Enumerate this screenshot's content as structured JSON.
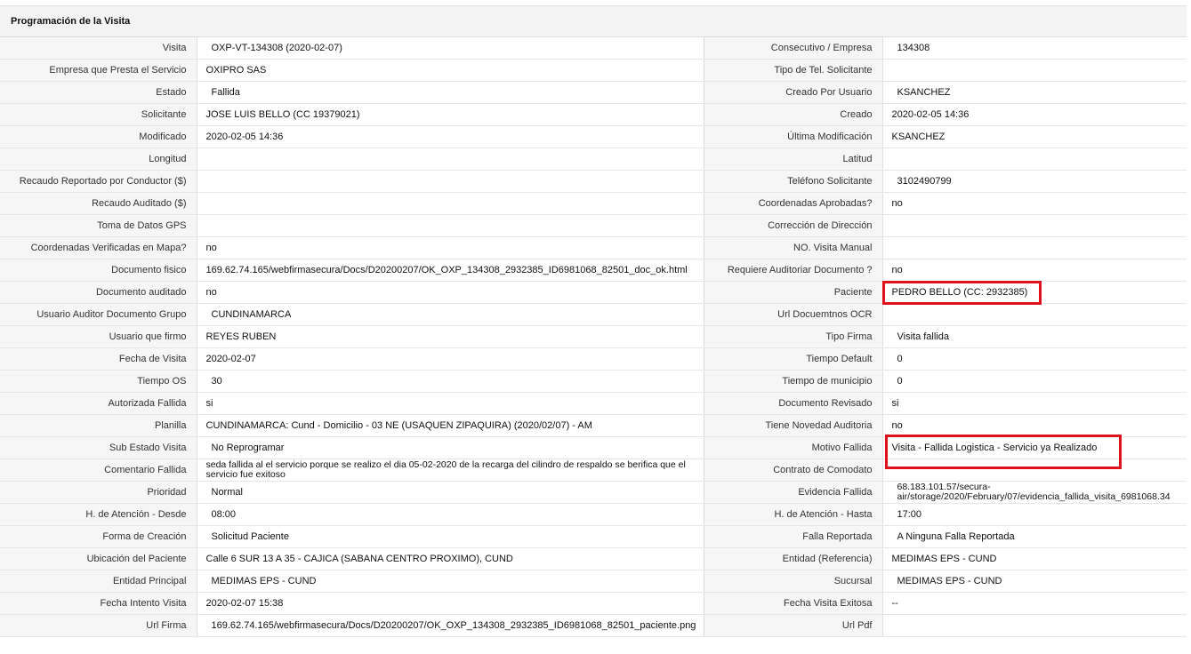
{
  "panel": {
    "title": "Programación de la Visita"
  },
  "colors": {
    "highlight": "#e0101c"
  },
  "rows": [
    {
      "l1": "Visita",
      "v1": "OXP-VT-134308 (2020-02-07)",
      "l2": "Consecutivo / Empresa",
      "v2": "134308"
    },
    {
      "l1": "Empresa que Presta el Servicio",
      "v1": "OXIPRO SAS",
      "l2": "Tipo de Tel. Solicitante",
      "v2": ""
    },
    {
      "l1": "Estado",
      "v1": "Fallida",
      "l2": "Creado Por Usuario",
      "v2": "KSANCHEZ"
    },
    {
      "l1": "Solicitante",
      "v1": "JOSE LUIS BELLO (CC 19379021)",
      "l2": "Creado",
      "v2": "2020-02-05 14:36"
    },
    {
      "l1": "Modificado",
      "v1": "2020-02-05 14:36",
      "l2": "Última Modificación",
      "v2": "KSANCHEZ"
    },
    {
      "l1": "Longitud",
      "v1": "",
      "l2": "Latitud",
      "v2": ""
    },
    {
      "l1": "Recaudo Reportado por Conductor ($)",
      "v1": "",
      "l2": "Teléfono Solicitante",
      "v2": "3102490799"
    },
    {
      "l1": "Recaudo Auditado ($)",
      "v1": "",
      "l2": "Coordenadas Aprobadas?",
      "v2": "no"
    },
    {
      "l1": "Toma de Datos GPS",
      "v1": "",
      "l2": "Corrección de Dirección",
      "v2": ""
    },
    {
      "l1": "Coordenadas Verificadas en Mapa?",
      "v1": "no",
      "l2": "NO. Visita Manual",
      "v2": ""
    },
    {
      "l1": "Documento fisico",
      "v1": "169.62.74.165/webfirmasecura/Docs/D20200207/OK_OXP_134308_2932385_ID6981068_82501_doc_ok.html",
      "l2": "Requiere Auditoriar Documento ?",
      "v2": "no"
    },
    {
      "l1": "Documento auditado",
      "v1": "no",
      "l2": "Paciente",
      "v2": "PEDRO BELLO (CC: 2932385)"
    },
    {
      "l1": "Usuario Auditor Documento Grupo",
      "v1": "CUNDINAMARCA",
      "l2": "Url Docuemtnos OCR",
      "v2": ""
    },
    {
      "l1": "Usuario que firmo",
      "v1": "REYES RUBEN",
      "l2": "Tipo Firma",
      "v2": "Visita fallida"
    },
    {
      "l1": "Fecha de Visita",
      "v1": "2020-02-07",
      "l2": "Tiempo Default",
      "v2": "0"
    },
    {
      "l1": "Tiempo OS",
      "v1": "30",
      "l2": "Tiempo de municipio",
      "v2": "0"
    },
    {
      "l1": "Autorizada Fallida",
      "v1": "si",
      "l2": "Documento Revisado",
      "v2": "si"
    },
    {
      "l1": "Planilla",
      "v1": "CUNDINAMARCA: Cund - Domicilio - 03 NE (USAQUEN ZIPAQUIRA) (2020/02/07) - AM",
      "l2": "Tiene Novedad Auditoria",
      "v2": "no"
    },
    {
      "l1": "Sub Estado Visita",
      "v1": "No Reprogramar",
      "l2": "Motivo Fallida",
      "v2": "Visita - Fallida Logistica - Servicio ya Realizado"
    },
    {
      "l1": "Comentario Fallida",
      "v1": "seda fallida al el servicio porque se realizo el dia 05-02-2020 de la recarga del cilindro de respaldo se berifica que el servicio fue exitoso",
      "l2": "Contrato de Comodato",
      "v2": ""
    },
    {
      "l1": "Prioridad",
      "v1": "Normal",
      "l2": "Evidencia Fallida",
      "v2": "68.183.101.57/secura-air/storage/2020/February/07/evidencia_fallida_visita_6981068.34"
    },
    {
      "l1": "H. de Atención - Desde",
      "v1": "08:00",
      "l2": "H. de Atención - Hasta",
      "v2": "17:00"
    },
    {
      "l1": "Forma de Creación",
      "v1": "Solicitud Paciente",
      "l2": "Falla Reportada",
      "v2": "A Ninguna Falla Reportada"
    },
    {
      "l1": "Ubicación del Paciente",
      "v1": "Calle 6 SUR 13 A 35 - CAJICA (SABANA CENTRO PROXIMO), CUND",
      "l2": "Entidad (Referencia)",
      "v2": "MEDIMAS EPS - CUND"
    },
    {
      "l1": "Entidad Principal",
      "v1": "MEDIMAS EPS - CUND",
      "l2": "Sucursal",
      "v2": "MEDIMAS EPS - CUND"
    },
    {
      "l1": "Fecha Intento Visita",
      "v1": "2020-02-07 15:38",
      "l2": "Fecha Visita Exitosa",
      "v2": "--"
    },
    {
      "l1": "Url Firma",
      "v1": "169.62.74.165/webfirmasecura/Docs/D20200207/OK_OXP_134308_2932385_ID6981068_82501_paciente.png",
      "l2": "Url Pdf",
      "v2": ""
    }
  ]
}
